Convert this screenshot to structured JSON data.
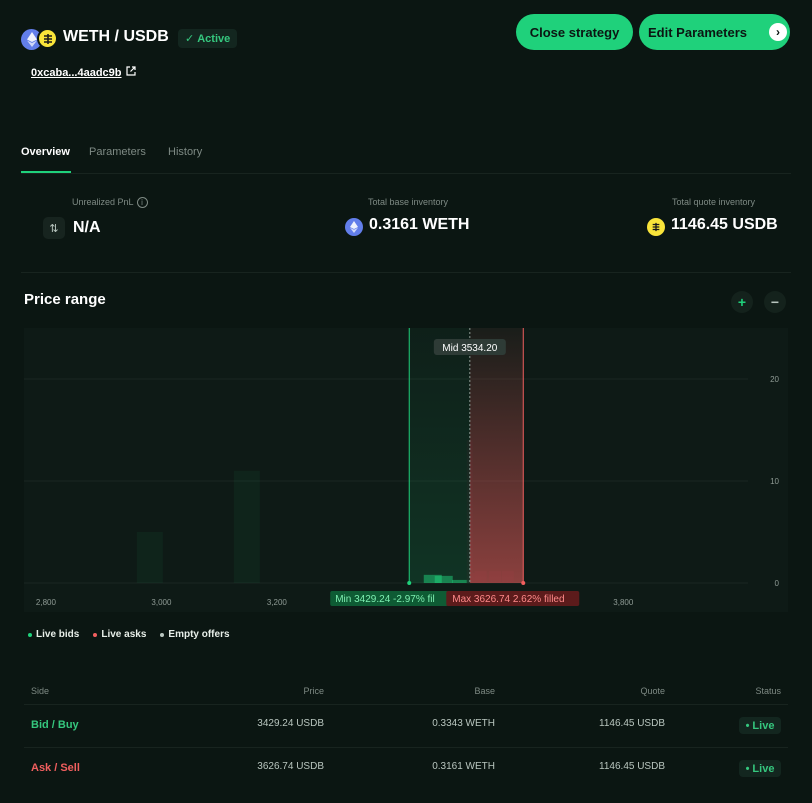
{
  "header": {
    "pair": "WETH / USDB",
    "status": "Active",
    "address": "0xcaba...4aadc9b",
    "close_label": "Close strategy",
    "edit_label": "Edit Parameters",
    "base_icon": "eth-icon",
    "quote_icon": "usdb-icon"
  },
  "tabs": [
    {
      "label": "Overview",
      "active": true
    },
    {
      "label": "Parameters",
      "active": false
    },
    {
      "label": "History",
      "active": false
    }
  ],
  "stats": {
    "pnl_label": "Unrealized PnL",
    "pnl_value": "N/A",
    "base_label": "Total base inventory",
    "base_value": "0.3161 WETH",
    "quote_label": "Total quote inventory",
    "quote_value": "1146.45 USDB"
  },
  "price_range": {
    "title": "Price range",
    "zoom_in": "+",
    "zoom_out": "−",
    "mid_label": "Mid 3534.20",
    "min_label": "Min 3429.24 -2.97% fil",
    "max_label": "Max 3626.74 2.62% filled"
  },
  "chart_data": {
    "type": "bar",
    "x_ticks": [
      2800,
      3000,
      3200,
      3800
    ],
    "x_tick_labels": [
      "2,800",
      "3,000",
      "3,200",
      "3,800"
    ],
    "y_ticks": [
      0,
      10,
      20
    ],
    "y_tick_labels": [
      "0",
      "10",
      "20"
    ],
    "xlim": [
      2762,
      4016
    ],
    "ylim": [
      0,
      25
    ],
    "mid_price": 3534.2,
    "min_price": 3429.24,
    "max_price": 3626.74,
    "bids": [
      {
        "x": 2980,
        "y": 5
      },
      {
        "x": 3148,
        "y": 11
      },
      {
        "x": 3470,
        "y": 0.8
      },
      {
        "x": 3489,
        "y": 0.7
      },
      {
        "x": 3519,
        "y": 0.3
      }
    ],
    "asks": [
      {
        "x": 3534,
        "y": 14
      },
      {
        "x": 3544,
        "y": 1
      },
      {
        "x": 3553,
        "y": 1.2
      },
      {
        "x": 3578,
        "y": 1.2
      },
      {
        "x": 3600,
        "y": 1.2
      }
    ],
    "colors": {
      "bid": "#1fd17b",
      "ask": "#f25f5f",
      "empty": "#8f9b95"
    }
  },
  "legend": [
    {
      "label": "Live bids",
      "color": "#1fd17b"
    },
    {
      "label": "Live asks",
      "color": "#f25f5f"
    },
    {
      "label": "Empty offers",
      "color": "#b9c6bf"
    }
  ],
  "table": {
    "headers": [
      "Side",
      "Price",
      "Base",
      "Quote",
      "Status"
    ],
    "rows": [
      {
        "side": "Bid / Buy",
        "price": "3429.24 USDB",
        "base": "0.3343 WETH",
        "quote": "1146.45 USDB",
        "status": "Live"
      },
      {
        "side": "Ask / Sell",
        "price": "3626.74 USDB",
        "base": "0.3161 WETH",
        "quote": "1146.45 USDB",
        "status": "Live"
      }
    ]
  }
}
